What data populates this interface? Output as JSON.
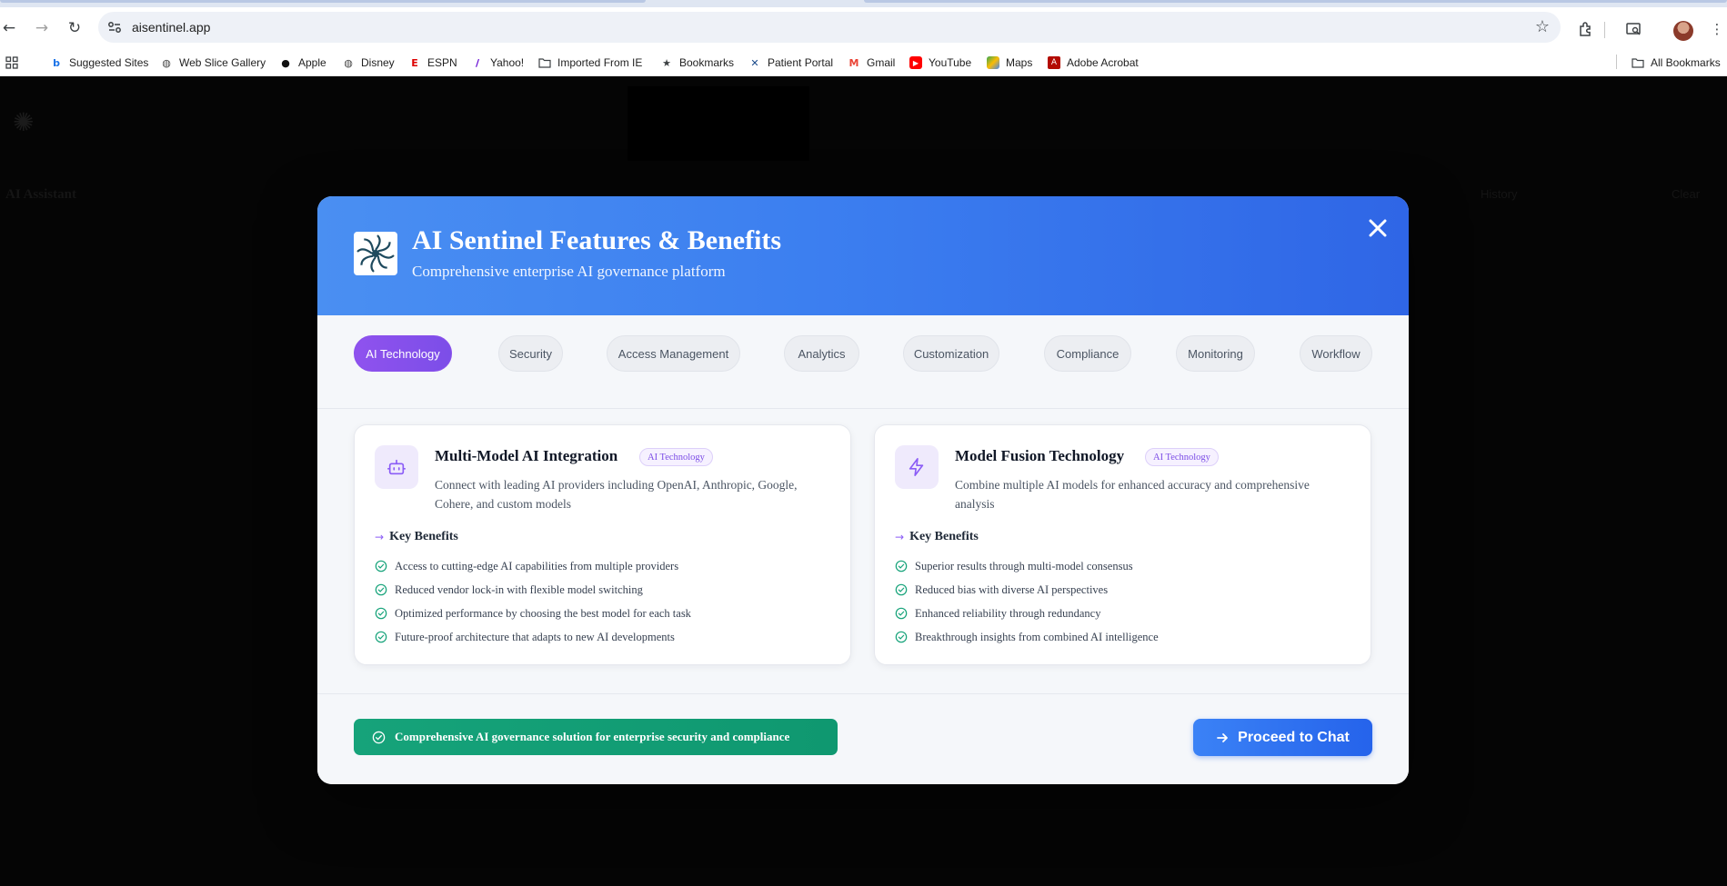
{
  "browser": {
    "url": "aisentinel.app",
    "bookmarks": [
      {
        "label": "Suggested Sites",
        "icon": "bing-icon"
      },
      {
        "label": "Web Slice Gallery",
        "icon": "globe-icon"
      },
      {
        "label": "Apple",
        "icon": "apple-icon"
      },
      {
        "label": "Disney",
        "icon": "globe-icon"
      },
      {
        "label": "ESPN",
        "icon": "espn-icon"
      },
      {
        "label": "Yahoo!",
        "icon": "yahoo-icon"
      },
      {
        "label": "Imported From IE",
        "icon": "folder-icon"
      },
      {
        "label": "Bookmarks",
        "icon": "star-icon"
      },
      {
        "label": "Patient Portal",
        "icon": "x-logo-icon"
      },
      {
        "label": "Gmail",
        "icon": "gmail-icon"
      },
      {
        "label": "YouTube",
        "icon": "youtube-icon"
      },
      {
        "label": "Maps",
        "icon": "maps-icon"
      },
      {
        "label": "Adobe Acrobat",
        "icon": "acrobat-icon"
      }
    ],
    "all_bookmarks": "All Bookmarks"
  },
  "background": {
    "app_title": "AI Assistant",
    "history": "History",
    "clear": "Clear"
  },
  "modal": {
    "title": "AI Sentinel Features & Benefits",
    "subtitle": "Comprehensive enterprise AI governance platform",
    "tabs": [
      {
        "label": "AI Technology",
        "active": true
      },
      {
        "label": "Security",
        "active": false
      },
      {
        "label": "Access Management",
        "active": false
      },
      {
        "label": "Analytics",
        "active": false
      },
      {
        "label": "Customization",
        "active": false
      },
      {
        "label": "Compliance",
        "active": false
      },
      {
        "label": "Monitoring",
        "active": false
      },
      {
        "label": "Workflow",
        "active": false
      }
    ],
    "cards": [
      {
        "title": "Multi-Model AI Integration",
        "badge": "AI Technology",
        "icon": "robot-icon",
        "description": "Connect with leading AI providers including OpenAI, Anthropic, Google, Cohere, and custom models",
        "key_benefits_label": "Key Benefits",
        "benefits": [
          "Access to cutting-edge AI capabilities from multiple providers",
          "Reduced vendor lock-in with flexible model switching",
          "Optimized performance by choosing the best model for each task",
          "Future-proof architecture that adapts to new AI developments"
        ]
      },
      {
        "title": "Model Fusion Technology",
        "badge": "AI Technology",
        "icon": "lightning-icon",
        "description": "Combine multiple AI models for enhanced accuracy and comprehensive analysis",
        "key_benefits_label": "Key Benefits",
        "benefits": [
          "Superior results through multi-model consensus",
          "Reduced bias with diverse AI perspectives",
          "Enhanced reliability through redundancy",
          "Breakthrough insights from combined AI intelligence"
        ]
      }
    ],
    "footer_banner": "Comprehensive AI governance solution for enterprise security and compliance",
    "proceed_label": "Proceed to Chat"
  },
  "colors": {
    "accent_purple": "#8b5cf6",
    "header_blue": "#3b82f6",
    "success_green": "#10a37f",
    "proceed_blue": "#2563eb"
  }
}
